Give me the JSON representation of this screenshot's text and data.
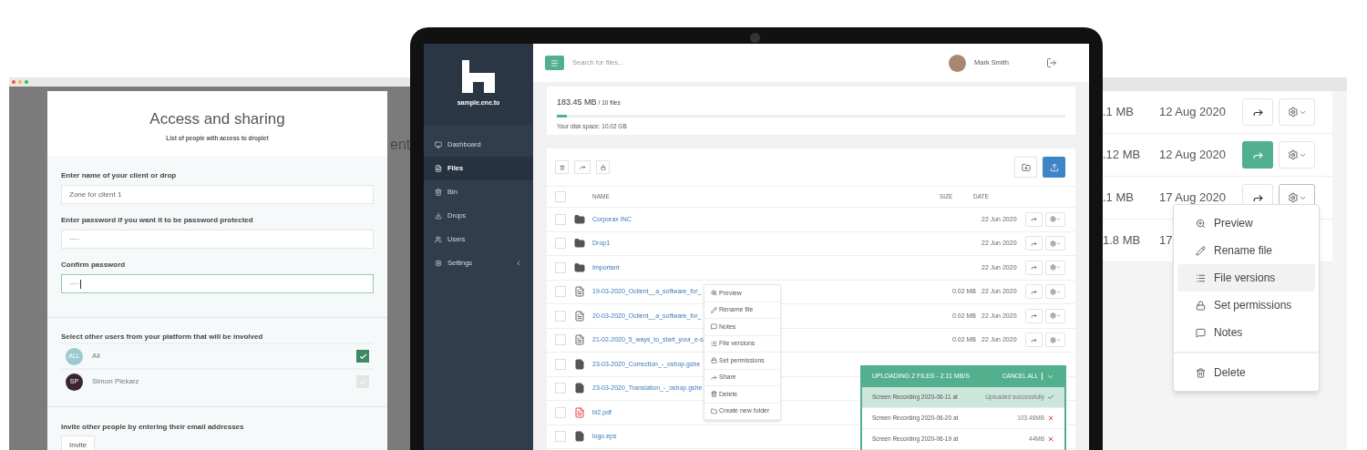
{
  "left_window": {
    "background_text": "ent",
    "modal": {
      "title": "Access and sharing",
      "subtitle": "List of people with access to droplet",
      "fields": [
        {
          "label": "Enter name of your client or drop",
          "value": "Zone for client 1",
          "focused": false
        },
        {
          "label": "Enter password if you want it to be password protected",
          "value": "····",
          "focused": false
        },
        {
          "label": "Confirm password",
          "value": "····",
          "focused": true
        }
      ],
      "users_label": "Select other users from your platform that will be involved",
      "users": [
        {
          "initials": "ALL",
          "name": "All",
          "checked": true,
          "color": "#9ccad3"
        },
        {
          "initials": "SP",
          "name": "Simon Piekarz",
          "checked": false,
          "color": "#3b2534"
        }
      ],
      "invite_label": "Invite other people by entering their email addresses",
      "invite_button": "Invite"
    }
  },
  "laptop": {
    "sidebar": {
      "site": "sample.ene.to",
      "items": [
        {
          "kind": "dashboard",
          "label": "Dashboard",
          "selected": false
        },
        {
          "kind": "files",
          "label": "Files",
          "selected": true
        },
        {
          "kind": "bin",
          "label": "Bin",
          "selected": false
        },
        {
          "kind": "drops",
          "label": "Drops",
          "selected": false
        },
        {
          "kind": "users",
          "label": "Users",
          "selected": false
        },
        {
          "kind": "settings",
          "label": "Settings",
          "selected": false,
          "expandable": true
        }
      ]
    },
    "topbar": {
      "search_placeholder": "Search for files...",
      "user_name": "Mark Smith"
    },
    "storage": {
      "used": "183.45 MB",
      "count": "/ 10 files",
      "level": 0.02,
      "disk_space": "Your disk space: 10.02 GB"
    },
    "table": {
      "columns": [
        "NAME",
        "SIZE",
        "DATE"
      ],
      "all_checked": false,
      "rows": [
        {
          "kind": "folder",
          "name": "Corporax INC",
          "date": "22 Jun 2020",
          "checked": false
        },
        {
          "kind": "folder",
          "name": "Drop1",
          "date": "22 Jun 2020",
          "checked": false
        },
        {
          "kind": "folder",
          "name": "Important",
          "date": "22 Jun 2020",
          "checked": false
        },
        {
          "kind": "word",
          "name": "19-03-2020_Oclient__a_software_for_",
          "size": "0.02 MB",
          "date": "22 Jun 2020",
          "checked": false
        },
        {
          "kind": "word",
          "name": "20-03-2020_Oclient__a_software_for_",
          "size": "0.02 MB",
          "date": "22 Jun 2020",
          "checked": false
        },
        {
          "kind": "word",
          "name": "21-02-2020_5_ways_to_start_your_e-s",
          "size": "0.02 MB",
          "date": "22 Jun 2020",
          "checked": false
        },
        {
          "kind": "file",
          "name": "23-03-2020_Correction_-_oshop.gshe",
          "checked": false
        },
        {
          "kind": "file",
          "name": "23-03-2020_Translation_-_oshop.gshe",
          "checked": false
        },
        {
          "kind": "pdf",
          "name": "bi2.pdf",
          "checked": false
        },
        {
          "kind": "file",
          "name": "logo.eps",
          "checked": false
        }
      ]
    },
    "context_menu": [
      {
        "kind": "preview",
        "label": "Preview"
      },
      {
        "kind": "rename",
        "label": "Rename file"
      },
      {
        "kind": "notes",
        "label": "Notes"
      },
      {
        "kind": "versions",
        "label": "File versions"
      },
      {
        "kind": "permissions",
        "label": "Set permissions"
      },
      {
        "kind": "share",
        "label": "Share"
      },
      {
        "kind": "delete",
        "label": "Delete"
      },
      {
        "kind": "folder",
        "label": "Create new folder"
      }
    ],
    "upload": {
      "title": "UPLOADING 2 FILES - 2.11 MB/S",
      "cancel": "CANCEL ALL",
      "items": [
        {
          "name": "Screen Recording 2020-06-11 at",
          "status": "Uploaded successfully",
          "kind": "done"
        },
        {
          "name": "Screen Recording 2020-06-20 at",
          "status": "103.46MB",
          "kind": "pending"
        },
        {
          "name": "Screen Recording 2020-06-19 at",
          "status": "44MB",
          "kind": "pending"
        }
      ]
    }
  },
  "right_panel": {
    "rows": [
      {
        "size": ".1 MB",
        "date": "12 Aug 2020",
        "share_active": false,
        "menu_open": false
      },
      {
        "size": ".12 MB",
        "date": "12 Aug 2020",
        "share_active": true,
        "menu_open": false
      },
      {
        "size": ".1 MB",
        "date": "17 Aug 2020",
        "share_active": false,
        "menu_open": true
      },
      {
        "size": "1.8 MB",
        "date": "17"
      }
    ],
    "menu": [
      {
        "kind": "preview",
        "label": "Preview",
        "selected": false
      },
      {
        "kind": "rename",
        "label": "Rename file",
        "selected": false
      },
      {
        "kind": "versions",
        "label": "File versions",
        "selected": true
      },
      {
        "kind": "permissions",
        "label": "Set permissions",
        "selected": false
      },
      {
        "kind": "notes",
        "label": "Notes",
        "selected": false
      },
      {
        "kind": "delete",
        "label": "Delete",
        "selected": false,
        "separated": true
      }
    ]
  }
}
